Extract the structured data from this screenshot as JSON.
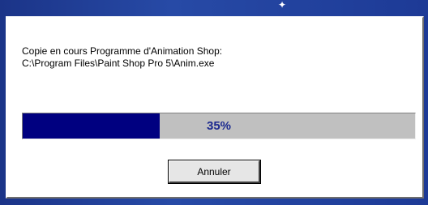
{
  "dialog": {
    "message_line1": "Copie en cours Programme d'Animation Shop:",
    "message_line2": "C:\\Program Files\\Paint Shop Pro 5\\Anim.exe",
    "progress": {
      "value_percent": 35,
      "label": "35%"
    },
    "cancel_label": "Annuler"
  },
  "colors": {
    "progress_fill": "#000080",
    "progress_track": "#c0c0c0",
    "progress_text": "#1c2a8f",
    "desktop": "#1f3a93"
  },
  "icons": {
    "cursor": "mouse-cursor-icon"
  }
}
